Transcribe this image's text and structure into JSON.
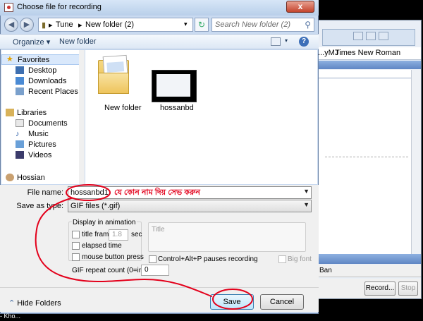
{
  "dialog": {
    "title": "Choose file for recording",
    "close_label": "x"
  },
  "address": {
    "crumbs": [
      "Tune",
      "New folder (2)"
    ],
    "search_placeholder": "Search New folder (2)"
  },
  "toolbar": {
    "organize_label": "Organize",
    "new_folder_label": "New folder"
  },
  "nav": {
    "favorites": "Favorites",
    "favorites_items": [
      "Desktop",
      "Downloads",
      "Recent Places"
    ],
    "libraries": "Libraries",
    "libraries_items": [
      "Documents",
      "Music",
      "Pictures",
      "Videos"
    ],
    "user": "Hossian"
  },
  "files": [
    {
      "name": "New folder",
      "kind": "folder"
    },
    {
      "name": "hossanbd",
      "kind": "gif"
    }
  ],
  "form": {
    "file_name_label": "File name:",
    "file_name_value": "hossanbd1",
    "save_type_label": "Save as type:",
    "save_type_value": "GIF files (*.gif)",
    "display_group_label": "Display in animation",
    "title_frame_label": "title frame:",
    "title_frame_value": "1.8",
    "title_frame_unit": "sec",
    "elapsed_time_label": "elapsed time",
    "mouse_press_label": "mouse button press",
    "title_group_label": "Title",
    "pause_label": "Control+Alt+P pauses recording",
    "big_font_label": "Big font",
    "repeat_label": "GIF repeat count (0=infinite):",
    "repeat_value": "0"
  },
  "footer": {
    "hide_folders_label": "Hide Folders",
    "save_label": "Save",
    "cancel_label": "Cancel"
  },
  "background_window": {
    "font_names": [
      "...yMJ",
      "Times New Roman"
    ],
    "toolbar_text": "Ban",
    "record_label": "Record...",
    "stop_label": "Stop"
  },
  "annotation": {
    "bengali_text": "যে কোন নাম দিয় সেভ করুন",
    "color": "#e3001b"
  },
  "bottom_text": "- Kho..."
}
